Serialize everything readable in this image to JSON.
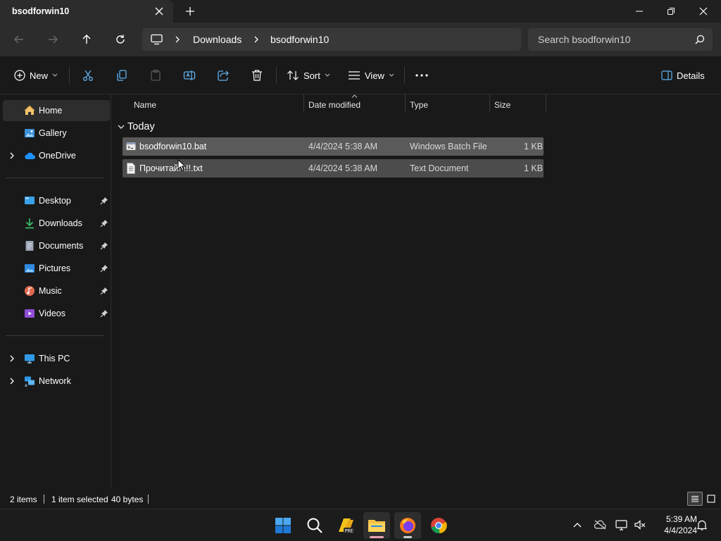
{
  "window": {
    "tab_title": "bsodforwin10"
  },
  "address": {
    "breadcrumb": [
      "Downloads",
      "bsodforwin10"
    ],
    "search_placeholder": "Search bsodforwin10"
  },
  "commands": {
    "new_label": "New",
    "sort_label": "Sort",
    "view_label": "View",
    "details_label": "Details"
  },
  "sidebar": {
    "items": [
      {
        "label": "Home",
        "icon": "home-icon",
        "selected": true
      },
      {
        "label": "Gallery",
        "icon": "gallery-icon"
      },
      {
        "label": "OneDrive",
        "icon": "onedrive-icon",
        "expandable": true
      },
      {
        "label": "Desktop",
        "icon": "desktop-icon",
        "pinned": true
      },
      {
        "label": "Downloads",
        "icon": "downloads-icon",
        "pinned": true
      },
      {
        "label": "Documents",
        "icon": "documents-icon",
        "pinned": true
      },
      {
        "label": "Pictures",
        "icon": "pictures-icon",
        "pinned": true
      },
      {
        "label": "Music",
        "icon": "music-icon",
        "pinned": true
      },
      {
        "label": "Videos",
        "icon": "videos-icon",
        "pinned": true
      },
      {
        "label": "This PC",
        "icon": "this-pc-icon",
        "expandable": true
      },
      {
        "label": "Network",
        "icon": "network-icon",
        "expandable": true
      }
    ]
  },
  "columns": {
    "name": "Name",
    "date": "Date modified",
    "type": "Type",
    "size": "Size"
  },
  "group": {
    "label": "Today"
  },
  "files": [
    {
      "name": "bsodforwin10.bat",
      "date": "4/4/2024 5:38 AM",
      "type": "Windows Batch File",
      "size": "1 KB",
      "icon": "batch-file-icon"
    },
    {
      "name": "Прочитай!!!!!.txt",
      "date": "4/4/2024 5:38 AM",
      "type": "Text Document",
      "size": "1 KB",
      "icon": "text-file-icon"
    }
  ],
  "status": {
    "item_count": "2 items",
    "selection": "1 item selected",
    "selection_size": "40 bytes"
  },
  "taskbar": {
    "time": "5:39 AM",
    "date": "4/4/2024",
    "apps": [
      "start-icon",
      "search-icon",
      "pre-app-icon",
      "file-explorer-icon",
      "firefox-icon",
      "chrome-icon"
    ]
  },
  "colors": {
    "accent": "#4cc2ff",
    "background": "#191919",
    "row_selected": "#5a5a5a"
  }
}
